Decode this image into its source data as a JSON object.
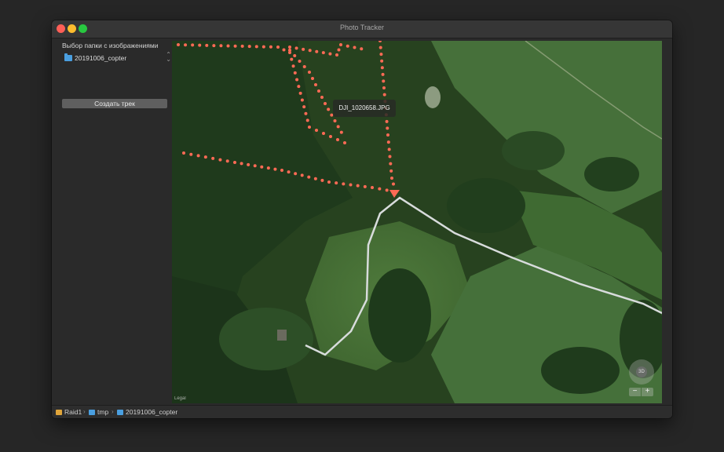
{
  "window": {
    "title": "Photo Tracker"
  },
  "sidebar": {
    "heading": "Выбор папки с изображениями",
    "folder": {
      "name": "20191006_copter",
      "icon": "folder-icon"
    },
    "create_button": "Создать трек"
  },
  "map": {
    "tooltip": "DJI_1020658.JPG",
    "legal": "Legal",
    "compass_label": "3D",
    "zoom_out": "−",
    "zoom_in": "+",
    "track_color": "#ff6a55",
    "road_color": "#d8dcdc"
  },
  "pathbar": {
    "items": [
      {
        "label": "Raid1",
        "icon": "disk-icon"
      },
      {
        "label": "tmp",
        "icon": "folder-icon"
      },
      {
        "label": "20191006_copter",
        "icon": "folder-icon"
      }
    ],
    "separator": "›"
  },
  "colors": {
    "accent": "#4a9fe0",
    "track": "#ff6a55",
    "close": "#ff5f57",
    "minimize": "#febc2e",
    "maximize": "#28c840"
  }
}
